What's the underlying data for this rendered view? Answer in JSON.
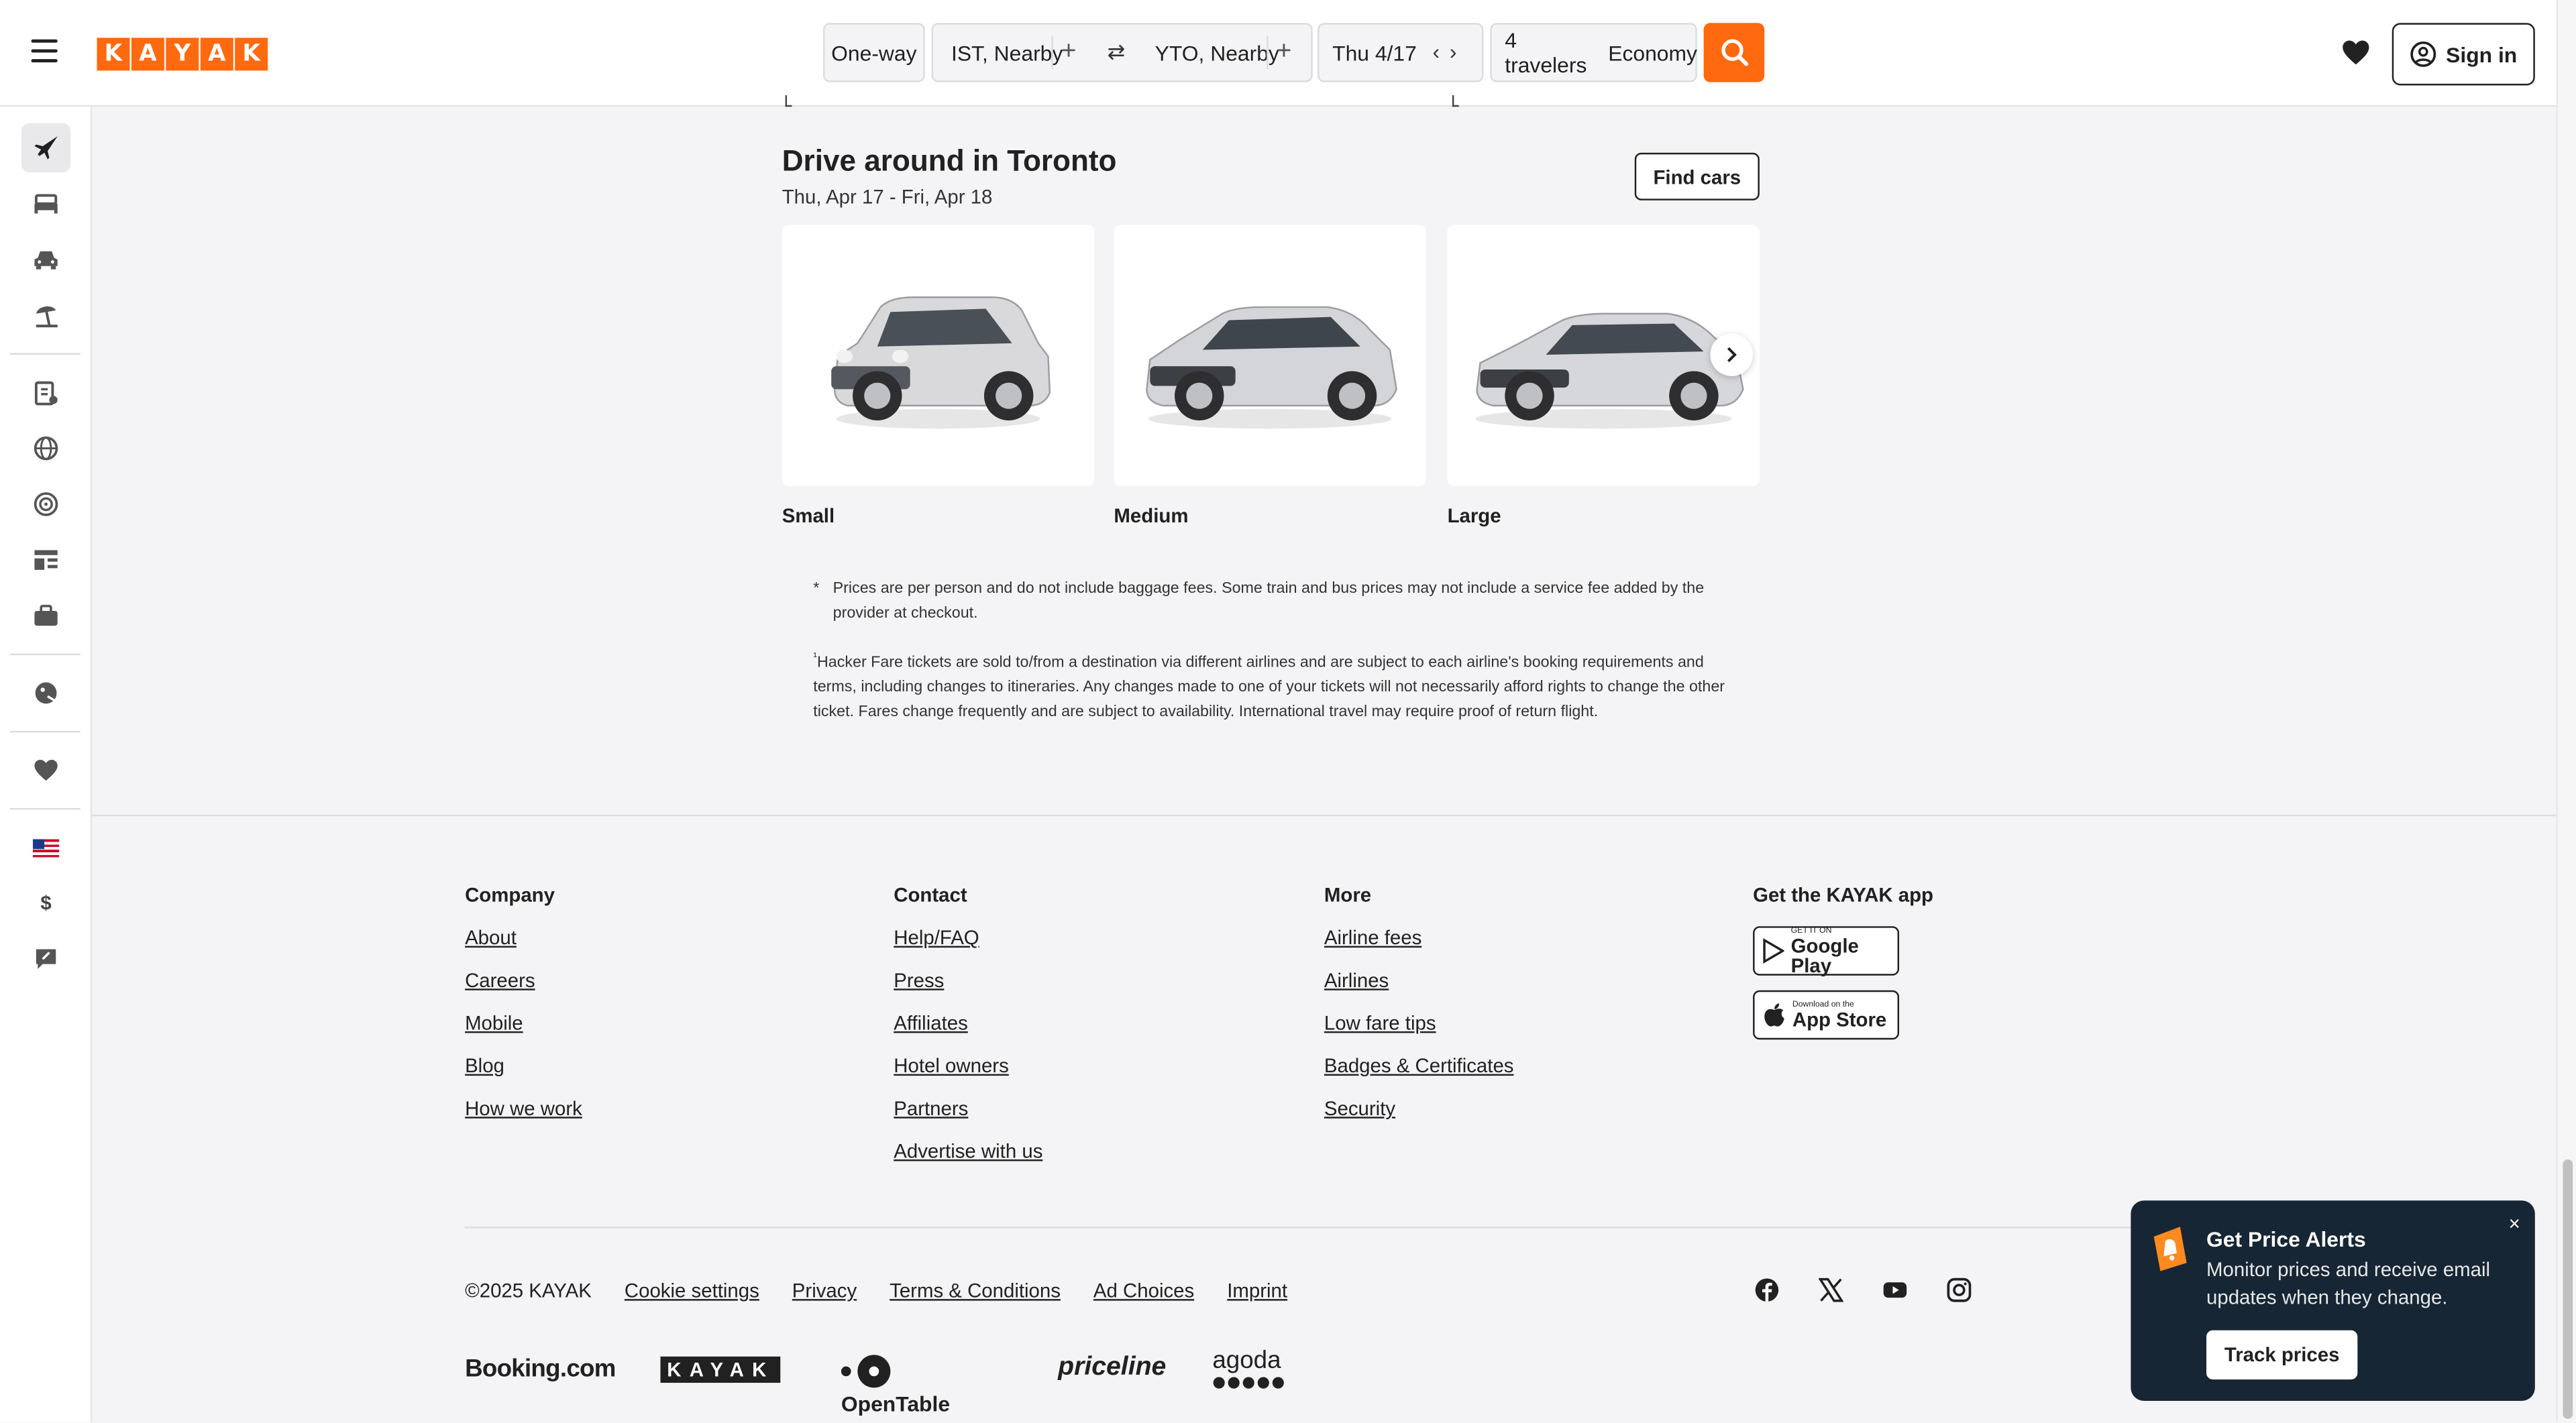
{
  "header": {
    "logo_letters": [
      "K",
      "A",
      "Y",
      "A",
      "K"
    ],
    "trip_type": "One-way",
    "origin": "IST, Nearby",
    "destination": "YTO, Nearby",
    "date": "Thu 4/17",
    "travelers": "4 travelers",
    "cabin": "Economy",
    "sign_in": "Sign in",
    "accent_color": "#ff690f"
  },
  "leftnav": {
    "icons": [
      "plane-icon",
      "bed-icon",
      "car-icon",
      "beach-umbrella-icon",
      "trips-icon",
      "globe-icon",
      "explore-icon",
      "news-icon",
      "business-icon",
      "deals-icon",
      "heart-icon",
      "us-flag-icon",
      "dollar-icon",
      "feedback-icon"
    ],
    "currency": "$"
  },
  "drive": {
    "title": "Drive around in Toronto",
    "dates": "Thu, Apr 17 - Fri, Apr 18",
    "find_cars": "Find cars",
    "cars": [
      {
        "label": "Small"
      },
      {
        "label": "Medium"
      },
      {
        "label": "Large"
      }
    ]
  },
  "notes": {
    "star": "*",
    "note1": "Prices are per person and do not include baggage fees. Some train and bus prices may not include a service fee added by the provider at checkout.",
    "note2_mark": "¹",
    "note2": "Hacker Fare tickets are sold to/from a destination via different airlines and are subject to each airline's booking requirements and terms, including changes to itineraries. Any changes made to one of your tickets will not necessarily afford rights to change the other ticket. Fares change frequently and are subject to availability. International travel may require proof of return flight."
  },
  "footer": {
    "company": {
      "heading": "Company",
      "links": [
        "About",
        "Careers",
        "Mobile",
        "Blog",
        "How we work"
      ]
    },
    "contact": {
      "heading": "Contact",
      "links": [
        "Help/FAQ",
        "Press",
        "Affiliates",
        "Hotel owners",
        "Partners",
        "Advertise with us"
      ]
    },
    "more": {
      "heading": "More",
      "links": [
        "Airline fees",
        "Airlines",
        "Low fare tips",
        "Badges & Certificates",
        "Security"
      ]
    },
    "app": {
      "heading": "Get the KAYAK app",
      "google_small": "GET IT ON",
      "google_big": "Google Play",
      "apple_small": "Download on the",
      "apple_big": "App Store"
    },
    "legal": {
      "copyright": "©2025 KAYAK",
      "links": [
        "Cookie settings",
        "Privacy",
        "Terms & Conditions",
        "Ad Choices",
        "Imprint"
      ]
    },
    "social": [
      "facebook-icon",
      "x-icon",
      "youtube-icon",
      "instagram-icon"
    ],
    "brands": [
      "Booking.com",
      "KAYAK",
      "OpenTable",
      "priceline",
      "agoda"
    ]
  },
  "popup": {
    "title": "Get Price Alerts",
    "text": "Monitor prices and receive email updates when they change.",
    "button": "Track prices",
    "close": "×",
    "background": "#172634"
  }
}
